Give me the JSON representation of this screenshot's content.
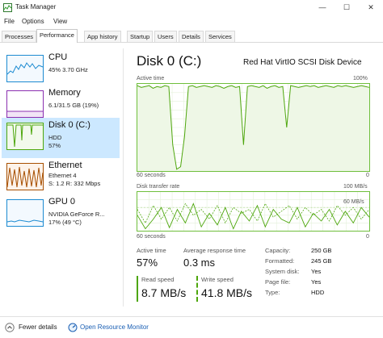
{
  "window": {
    "title": "Task Manager",
    "minimize_glyph": "—",
    "maximize_glyph": "☐",
    "close_glyph": "✕"
  },
  "menu": {
    "items": [
      "File",
      "Options",
      "View"
    ]
  },
  "tabs": [
    "Processes",
    "Performance",
    "App history",
    "Startup",
    "Users",
    "Details",
    "Services"
  ],
  "active_tab": "Performance",
  "sidebar": {
    "items": [
      {
        "title": "CPU",
        "lines": [
          "45% 3.70 GHz"
        ],
        "color": "#1d8bd1"
      },
      {
        "title": "Memory",
        "lines": [
          "6.1/31.5 GB (19%)"
        ],
        "color": "#8b2fb0"
      },
      {
        "title": "Disk 0 (C:)",
        "lines": [
          "HDD",
          "57%"
        ],
        "color": "#4da60c",
        "selected": true
      },
      {
        "title": "Ethernet",
        "lines": [
          "Ethernet 4",
          "S: 1.2  R: 332 Mbps"
        ],
        "color": "#a74f01"
      },
      {
        "title": "GPU 0",
        "lines": [
          "NVIDIA GeForce R...",
          "17% (49 °C)"
        ],
        "color": "#1d8bd1"
      }
    ]
  },
  "main": {
    "title": "Disk 0 (C:)",
    "device": "Red Hat VirtIO SCSI Disk Device",
    "graph1": {
      "label": "Active time",
      "max": "100%",
      "time_label": "60 seconds",
      "min": "0",
      "series": [
        98,
        96,
        97,
        98,
        95,
        97,
        96,
        98,
        97,
        30,
        2,
        5,
        40,
        97,
        98,
        96,
        97,
        98,
        97,
        96,
        98,
        97,
        95,
        97,
        98,
        96,
        97,
        30,
        97,
        98,
        97,
        96,
        98,
        95,
        97,
        98,
        96,
        97,
        50,
        98,
        97,
        96,
        97,
        98,
        97,
        98,
        96,
        97,
        98,
        97,
        96,
        98,
        97,
        98,
        97,
        96,
        97,
        98,
        97,
        96
      ]
    },
    "graph2": {
      "label": "Disk transfer rate",
      "max": "100 MB/s",
      "sub_label": "60 MB/s",
      "time_label": "60 seconds",
      "min": "0",
      "read_series": [
        40,
        5,
        30,
        60,
        8,
        55,
        20,
        70,
        10,
        45,
        15,
        60,
        5,
        50,
        25,
        65,
        10,
        55,
        30,
        20,
        60,
        10,
        45,
        25,
        55,
        15,
        50,
        20,
        60,
        35
      ],
      "write_series": [
        55,
        20,
        65,
        30,
        60,
        25,
        70,
        40,
        55,
        30,
        65,
        20,
        60,
        45,
        55,
        25,
        70,
        35,
        50,
        65,
        30,
        60,
        40,
        55,
        25,
        65,
        40,
        60,
        30,
        55
      ]
    },
    "stats": {
      "active_time_label": "Active time",
      "active_time_value": "57%",
      "avg_resp_label": "Average response time",
      "avg_resp_value": "0.3 ms",
      "read_speed_label": "Read speed",
      "read_speed_value": "8.7 MB/s",
      "write_speed_label": "Write speed",
      "write_speed_value": "41.8 MB/s"
    },
    "properties": [
      {
        "key": "Capacity:",
        "value": "250 GB"
      },
      {
        "key": "Formatted:",
        "value": "245 GB"
      },
      {
        "key": "System disk:",
        "value": "Yes"
      },
      {
        "key": "Page file:",
        "value": "Yes"
      },
      {
        "key": "Type:",
        "value": "HDD"
      }
    ]
  },
  "footer": {
    "fewer_details": "Fewer details",
    "open_resource_monitor": "Open Resource Monitor"
  },
  "colors": {
    "disk_green": "#4da60c",
    "selected_bg": "#cce8ff",
    "link": "#1a5fb4"
  }
}
